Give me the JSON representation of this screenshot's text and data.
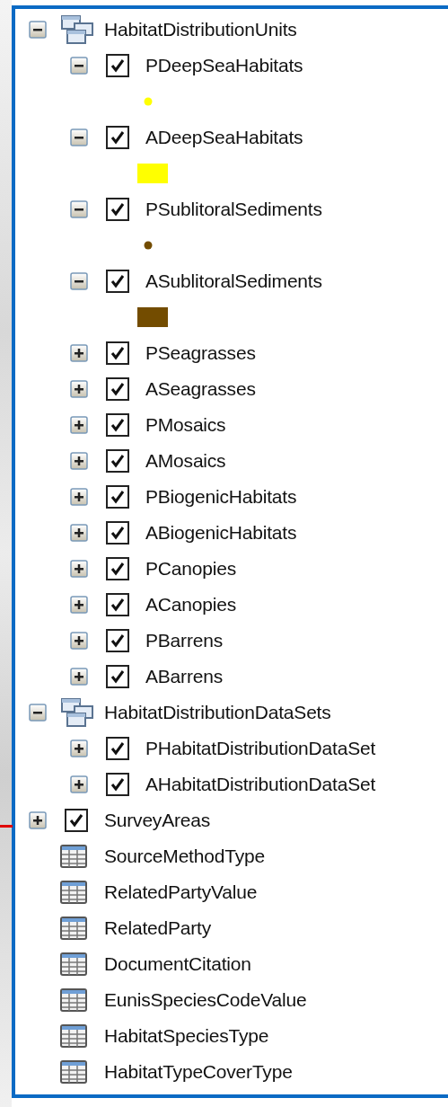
{
  "tree": [
    {
      "kind": "group",
      "label": "HabitatDistributionUnits",
      "expanded": true,
      "children": [
        {
          "kind": "layer",
          "label": "PDeepSeaHabitats",
          "expanded": true,
          "checked": true,
          "symbol": {
            "kind": "point",
            "color": "#ffff00"
          }
        },
        {
          "kind": "layer",
          "label": "ADeepSeaHabitats",
          "expanded": true,
          "checked": true,
          "symbol": {
            "kind": "polygon",
            "color": "#ffff00"
          }
        },
        {
          "kind": "layer",
          "label": "PSublitoralSediments",
          "expanded": true,
          "checked": true,
          "symbol": {
            "kind": "point",
            "color": "#734c00"
          }
        },
        {
          "kind": "layer",
          "label": "ASublitoralSediments",
          "expanded": true,
          "checked": true,
          "symbol": {
            "kind": "polygon",
            "color": "#734c00"
          }
        },
        {
          "kind": "layer",
          "label": "PSeagrasses",
          "expanded": false,
          "checked": true
        },
        {
          "kind": "layer",
          "label": "ASeagrasses",
          "expanded": false,
          "checked": true
        },
        {
          "kind": "layer",
          "label": "PMosaics",
          "expanded": false,
          "checked": true
        },
        {
          "kind": "layer",
          "label": "AMosaics",
          "expanded": false,
          "checked": true
        },
        {
          "kind": "layer",
          "label": "PBiogenicHabitats",
          "expanded": false,
          "checked": true
        },
        {
          "kind": "layer",
          "label": "ABiogenicHabitats",
          "expanded": false,
          "checked": true
        },
        {
          "kind": "layer",
          "label": "PCanopies",
          "expanded": false,
          "checked": true
        },
        {
          "kind": "layer",
          "label": "ACanopies",
          "expanded": false,
          "checked": true
        },
        {
          "kind": "layer",
          "label": "PBarrens",
          "expanded": false,
          "checked": true
        },
        {
          "kind": "layer",
          "label": "ABarrens",
          "expanded": false,
          "checked": true
        }
      ]
    },
    {
      "kind": "group",
      "label": "HabitatDistributionDataSets",
      "expanded": true,
      "children": [
        {
          "kind": "layer",
          "label": "PHabitatDistributionDataSet",
          "expanded": false,
          "checked": true
        },
        {
          "kind": "layer",
          "label": "AHabitatDistributionDataSet",
          "expanded": false,
          "checked": true
        }
      ]
    },
    {
      "kind": "layer",
      "label": "SurveyAreas",
      "expanded": false,
      "checked": true
    },
    {
      "kind": "table",
      "label": "SourceMethodType"
    },
    {
      "kind": "table",
      "label": "RelatedPartyValue"
    },
    {
      "kind": "table",
      "label": "RelatedParty"
    },
    {
      "kind": "table",
      "label": "DocumentCitation"
    },
    {
      "kind": "table",
      "label": "EunisSpeciesCodeValue"
    },
    {
      "kind": "table",
      "label": "HabitatSpeciesType"
    },
    {
      "kind": "table",
      "label": "HabitatTypeCoverType"
    }
  ]
}
